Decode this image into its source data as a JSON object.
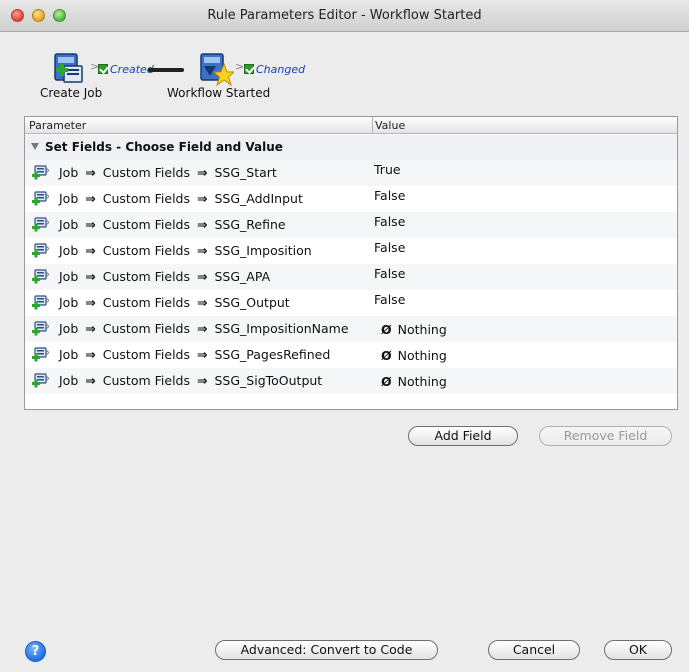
{
  "window": {
    "title": "Rule Parameters Editor - Workflow Started"
  },
  "flow": {
    "nodes": [
      {
        "label": "Create Job",
        "status": "Created",
        "icon": "create-job-icon"
      },
      {
        "label": "Workflow Started",
        "status": "Changed",
        "icon": "workflow-started-icon"
      }
    ]
  },
  "table": {
    "headers": {
      "parameter": "Parameter",
      "value": "Value"
    },
    "group_label": "Set Fields - Choose Field and Value",
    "rows": [
      {
        "path": [
          "Job",
          "Custom Fields",
          "SSG_Start"
        ],
        "value": "True"
      },
      {
        "path": [
          "Job",
          "Custom Fields",
          "SSG_AddInput"
        ],
        "value": "False"
      },
      {
        "path": [
          "Job",
          "Custom Fields",
          "SSG_Refine"
        ],
        "value": "False"
      },
      {
        "path": [
          "Job",
          "Custom Fields",
          "SSG_Imposition"
        ],
        "value": "False"
      },
      {
        "path": [
          "Job",
          "Custom Fields",
          "SSG_APA"
        ],
        "value": "False"
      },
      {
        "path": [
          "Job",
          "Custom Fields",
          "SSG_Output"
        ],
        "value": "False"
      },
      {
        "path": [
          "Job",
          "Custom Fields",
          "SSG_ImpositionName"
        ],
        "value": "Nothing",
        "null": true
      },
      {
        "path": [
          "Job",
          "Custom Fields",
          "SSG_PagesRefined"
        ],
        "value": "Nothing",
        "null": true
      },
      {
        "path": [
          "Job",
          "Custom Fields",
          "SSG_SigToOutput"
        ],
        "value": "Nothing",
        "null": true
      }
    ],
    "arrow_glyph": "⇒",
    "null_glyph": "Ø"
  },
  "buttons": {
    "add_field": "Add Field",
    "remove_field": "Remove Field",
    "advanced": "Advanced: Convert to Code",
    "cancel": "Cancel",
    "ok": "OK",
    "help": "?"
  },
  "colors": {
    "status_text": "#1a3fbf",
    "check_green": "#2d9a2d",
    "help_blue": "#1f6fe0"
  }
}
